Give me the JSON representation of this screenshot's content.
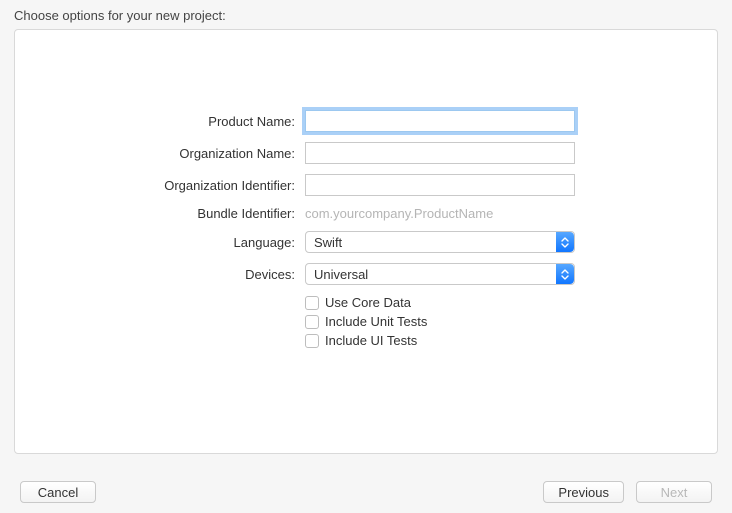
{
  "header": {
    "title": "Choose options for your new project:"
  },
  "form": {
    "productName": {
      "label": "Product Name:",
      "value": ""
    },
    "orgName": {
      "label": "Organization Name:",
      "value": ""
    },
    "orgId": {
      "label": "Organization Identifier:",
      "value": ""
    },
    "bundleId": {
      "label": "Bundle Identifier:",
      "value": "com.yourcompany.ProductName"
    },
    "language": {
      "label": "Language:",
      "selected": "Swift"
    },
    "devices": {
      "label": "Devices:",
      "selected": "Universal"
    },
    "useCoreData": {
      "label": "Use Core Data",
      "checked": false
    },
    "includeUnitTests": {
      "label": "Include Unit Tests",
      "checked": false
    },
    "includeUITests": {
      "label": "Include UI Tests",
      "checked": false
    }
  },
  "buttons": {
    "cancel": "Cancel",
    "previous": "Previous",
    "next": "Next"
  }
}
